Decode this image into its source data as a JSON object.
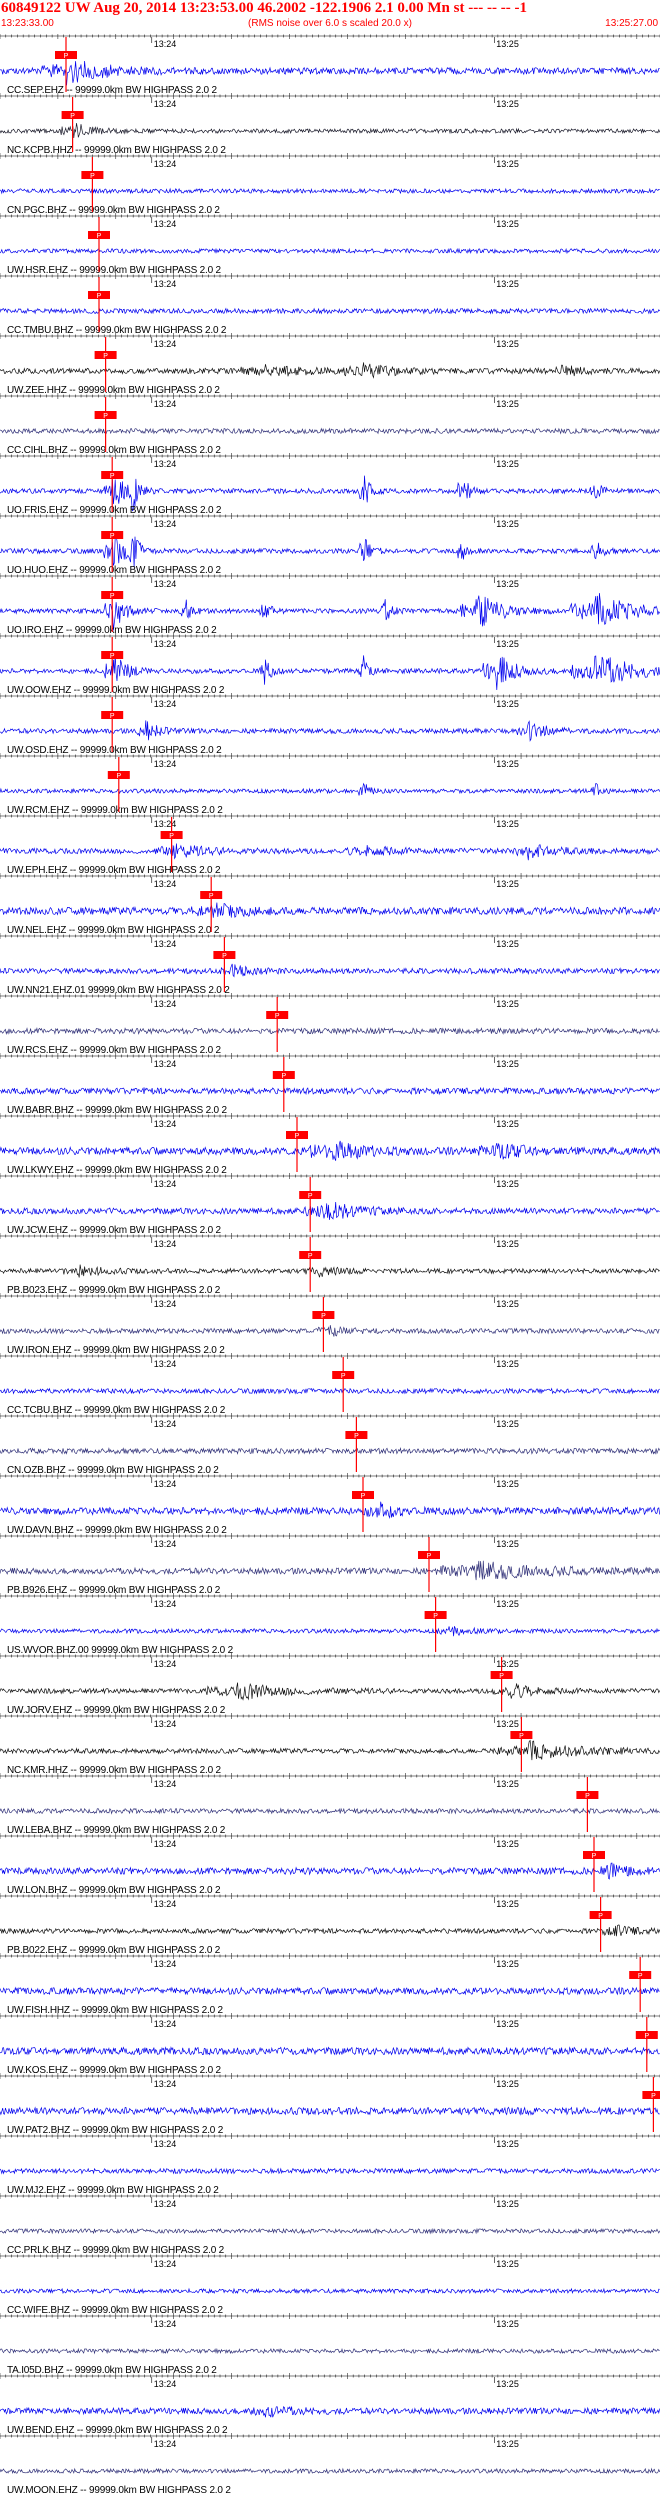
{
  "header": {
    "title": "60849122 UW Aug 20, 2014 13:23:53.00   46.2002 -122.1906  2.1 0.00 Mn st --- -- --   -1",
    "start_time": "13:23:33.00",
    "note": "(RMS noise over 6.0 s scaled 20.0 x)",
    "end_time": "13:25:27.00"
  },
  "chart_data": {
    "type": "seismogram",
    "x_axis": {
      "start": "13:23:33.00",
      "end": "13:25:27.00",
      "tick_labels": [
        "13:24",
        "13:25"
      ]
    },
    "pick_label": "P",
    "channels": [
      {
        "label": "CC.SEP.EHZ -- 99999.0km BW  HIGHPASS  2.0  2",
        "color": "#0000ee",
        "pick": 10,
        "amp": 0.55,
        "events": [
          [
            10,
            6,
            3.6
          ]
        ]
      },
      {
        "label": "NC.KCPB.HHZ -- 99999.0km BW  HIGHPASS  2.0  2",
        "color": "#1a1a2a",
        "pick": 11,
        "amp": 0.35,
        "events": [
          [
            11,
            3,
            4
          ]
        ]
      },
      {
        "label": "CN.PGC.BHZ -- 99999.0km BW  HIGHPASS  2.0  2",
        "color": "#0000ee",
        "pick": 14,
        "amp": 0.35,
        "events": []
      },
      {
        "label": "UW.HSR.EHZ -- 99999.0km BW  HIGHPASS  2.0  2",
        "color": "#0000ee",
        "pick": 15,
        "amp": 0.35,
        "events": []
      },
      {
        "label": "CC.TMBU.BHZ -- 99999.0km BW  HIGHPASS  2.0  2",
        "color": "#0000ee",
        "pick": 15,
        "amp": 0.4,
        "events": []
      },
      {
        "label": "UW.ZEE.HHZ -- 99999.0km BW  HIGHPASS  2.0  2",
        "color": "#111111",
        "pick": 16,
        "amp": 0.45,
        "events": [
          [
            40,
            6,
            2
          ],
          [
            55,
            5,
            2.2
          ],
          [
            85,
            3,
            2
          ]
        ]
      },
      {
        "label": "CC.CIHL.BHZ -- 99999.0km BW  HIGHPASS  2.0  2",
        "color": "#33337a",
        "pick": 16,
        "amp": 0.4,
        "events": []
      },
      {
        "label": "UO.FRIS.EHZ -- 99999.0km BW  HIGHPASS  2.0  2",
        "color": "#0000ee",
        "pick": 17,
        "amp": 0.4,
        "events": [
          [
            17,
            2,
            8
          ],
          [
            20,
            1,
            8
          ],
          [
            55,
            1,
            8
          ],
          [
            70,
            1,
            8
          ],
          [
            90,
            1,
            6
          ]
        ]
      },
      {
        "label": "UO.HUO.EHZ -- 99999.0km BW  HIGHPASS  2.0  2",
        "color": "#0000ee",
        "pick": 17,
        "amp": 0.4,
        "events": [
          [
            17,
            2,
            8
          ],
          [
            20,
            1,
            8
          ],
          [
            55,
            1,
            8
          ],
          [
            70,
            1,
            8
          ],
          [
            90,
            1,
            6
          ]
        ]
      },
      {
        "label": "UO.IRO.EHZ -- 99999.0km BW  HIGHPASS  2.0  2",
        "color": "#0000ee",
        "pick": 17,
        "amp": 0.4,
        "events": [
          [
            17,
            2,
            8
          ],
          [
            28,
            1,
            6
          ],
          [
            40,
            1,
            6
          ],
          [
            58,
            1,
            8
          ],
          [
            72,
            4,
            8
          ],
          [
            90,
            6,
            8
          ]
        ]
      },
      {
        "label": "UW.OOW.EHZ -- 99999.0km BW  HIGHPASS  2.0  2",
        "color": "#0000ee",
        "pick": 17,
        "amp": 0.4,
        "events": [
          [
            17,
            2,
            8
          ],
          [
            40,
            1,
            6
          ],
          [
            55,
            1,
            8
          ],
          [
            75,
            3,
            8
          ],
          [
            90,
            6,
            8
          ]
        ]
      },
      {
        "label": "UW.OSD.EHZ -- 99999.0km BW  HIGHPASS  2.0  2",
        "color": "#0000ee",
        "pick": 17,
        "amp": 0.4,
        "events": [
          [
            22,
            2,
            4
          ],
          [
            80,
            3,
            4
          ]
        ]
      },
      {
        "label": "UW.RCM.EHZ -- 99999.0km BW  HIGHPASS  2.0  2",
        "color": "#0000ee",
        "pick": 18,
        "amp": 0.35,
        "events": [
          [
            55,
            1,
            4
          ],
          [
            90,
            1,
            4
          ]
        ]
      },
      {
        "label": "UW.EPH.EHZ -- 99999.0km BW  HIGHPASS  2.0  2",
        "color": "#0000ee",
        "pick": 26,
        "amp": 0.45,
        "events": [
          [
            26,
            5,
            2.5
          ],
          [
            55,
            4,
            2
          ],
          [
            80,
            4,
            2.5
          ]
        ]
      },
      {
        "label": "UW.NEL.EHZ -- 99999.0km BW  HIGHPASS  2.0  2",
        "color": "#0000ee",
        "pick": 32,
        "amp": 0.6,
        "events": [
          [
            32,
            5,
            2
          ]
        ]
      },
      {
        "label": "UW.NN21.EHZ.01 99999.0km BW  HIGHPASS  2.0  2",
        "color": "#0000ee",
        "pick": 34,
        "amp": 0.45,
        "events": [
          [
            35,
            3,
            2
          ]
        ]
      },
      {
        "label": "UW.RCS.EHZ -- 99999.0km BW  HIGHPASS  2.0  2",
        "color": "#33337a",
        "pick": 42,
        "amp": 0.45,
        "events": []
      },
      {
        "label": "UW.BABR.BHZ -- 99999.0km BW  HIGHPASS  2.0  2",
        "color": "#0000ee",
        "pick": 43,
        "amp": 0.5,
        "events": []
      },
      {
        "label": "UW.LKWY.EHZ -- 99999.0km BW  HIGHPASS  2.0  2",
        "color": "#0000ee",
        "pick": 45,
        "amp": 0.6,
        "events": [
          [
            50,
            5,
            3
          ],
          [
            75,
            5,
            2
          ]
        ]
      },
      {
        "label": "UW.JCW.EHZ -- 99999.0km BW  HIGHPASS  2.0  2",
        "color": "#0000ee",
        "pick": 47,
        "amp": 0.5,
        "events": [
          [
            49,
            5,
            3.2
          ]
        ]
      },
      {
        "label": "PB.B023.EHZ -- 99999.0km BW  HIGHPASS  2.0  2",
        "color": "#111111",
        "pick": 47,
        "amp": 0.4,
        "events": [
          [
            12,
            4,
            2
          ],
          [
            48,
            3,
            2
          ]
        ]
      },
      {
        "label": "UW.IRON.EHZ -- 99999.0km BW  HIGHPASS  2.0  2",
        "color": "#33337a",
        "pick": 49,
        "amp": 0.4,
        "events": [
          [
            50,
            3,
            2
          ]
        ]
      },
      {
        "label": "CC.TCBU.BHZ -- 99999.0km BW  HIGHPASS  2.0  2",
        "color": "#0000ee",
        "pick": 52,
        "amp": 0.4,
        "events": []
      },
      {
        "label": "CN.OZB.BHZ -- 99999.0km BW  HIGHPASS  2.0  2",
        "color": "#33337a",
        "pick": 54,
        "amp": 0.45,
        "events": []
      },
      {
        "label": "UW.DAVN.BHZ -- 99999.0km BW  HIGHPASS  2.0  2",
        "color": "#0000ee",
        "pick": 55,
        "amp": 0.6,
        "events": [
          [
            57,
            3,
            2.2
          ]
        ]
      },
      {
        "label": "PB.B926.EHZ -- 99999.0km BW  HIGHPASS  2.0  2",
        "color": "#33337a",
        "pick": 65,
        "amp": 0.5,
        "events": [
          [
            72,
            10,
            3
          ]
        ]
      },
      {
        "label": "US.WVOR.BHZ.00 99999.0km BW  HIGHPASS  2.0  2",
        "color": "#0000ee",
        "pick": 66,
        "amp": 0.35,
        "events": [
          [
            68,
            3,
            2
          ]
        ]
      },
      {
        "label": "UW.JORV.EHZ -- 99999.0km BW  HIGHPASS  2.0  2",
        "color": "#111111",
        "pick": 76,
        "amp": 0.4,
        "events": [
          [
            36,
            8,
            3.2
          ],
          [
            77,
            4,
            3.4
          ]
        ]
      },
      {
        "label": "NC.KMR.HHZ -- 99999.0km BW  HIGHPASS  2.0  2",
        "color": "#111111",
        "pick": 79,
        "amp": 0.4,
        "events": [
          [
            80,
            8,
            3.6
          ]
        ]
      },
      {
        "label": "UW.LEBA.BHZ -- 99999.0km BW  HIGHPASS  2.0  2",
        "color": "#33337a",
        "pick": 89,
        "amp": 0.4,
        "events": []
      },
      {
        "label": "UW.LON.BHZ -- 99999.0km BW  HIGHPASS  2.0  2",
        "color": "#0000ee",
        "pick": 90,
        "amp": 0.55,
        "events": [
          [
            92,
            3,
            2
          ]
        ]
      },
      {
        "label": "PB.B022.EHZ -- 99999.0km BW  HIGHPASS  2.0  2",
        "color": "#111111",
        "pick": 91,
        "amp": 0.4,
        "events": [
          [
            93,
            3,
            2.5
          ]
        ]
      },
      {
        "label": "UW.FISH.HHZ -- 99999.0km BW  HIGHPASS  2.0  2",
        "color": "#0000ee",
        "pick": 97,
        "amp": 0.55,
        "events": []
      },
      {
        "label": "UW.KOS.EHZ -- 99999.0km BW  HIGHPASS  2.0  2",
        "color": "#0000ee",
        "pick": 98,
        "amp": 0.6,
        "events": []
      },
      {
        "label": "UW.PAT2.BHZ -- 99999.0km BW  HIGHPASS  2.0  2",
        "color": "#0000ee",
        "pick": 99,
        "amp": 0.6,
        "events": []
      },
      {
        "label": "UW.MJ2.EHZ -- 99999.0km BW  HIGHPASS  2.0  2",
        "color": "#0000ee",
        "pick": null,
        "amp": 0.4,
        "events": []
      },
      {
        "label": "CC.PRLK.BHZ -- 99999.0km BW  HIGHPASS  2.0  2",
        "color": "#33337a",
        "pick": null,
        "amp": 0.35,
        "events": []
      },
      {
        "label": "CC.WIFE.BHZ -- 99999.0km BW  HIGHPASS  2.0  2",
        "color": "#0000ee",
        "pick": null,
        "amp": 0.35,
        "events": []
      },
      {
        "label": "TA.I05D.BHZ -- 99999.0km BW  HIGHPASS  2.0  2",
        "color": "#33337a",
        "pick": null,
        "amp": 0.35,
        "events": []
      },
      {
        "label": "UW.BEND.EHZ -- 99999.0km BW  HIGHPASS  2.0  2",
        "color": "#0000ee",
        "pick": null,
        "amp": 0.5,
        "events": [
          [
            40,
            4,
            1.8
          ]
        ]
      },
      {
        "label": "UW.MOON.EHZ -- 99999.0km BW  HIGHPASS  2.0  2",
        "color": "#33337a",
        "pick": null,
        "amp": 0.35,
        "events": []
      }
    ]
  }
}
